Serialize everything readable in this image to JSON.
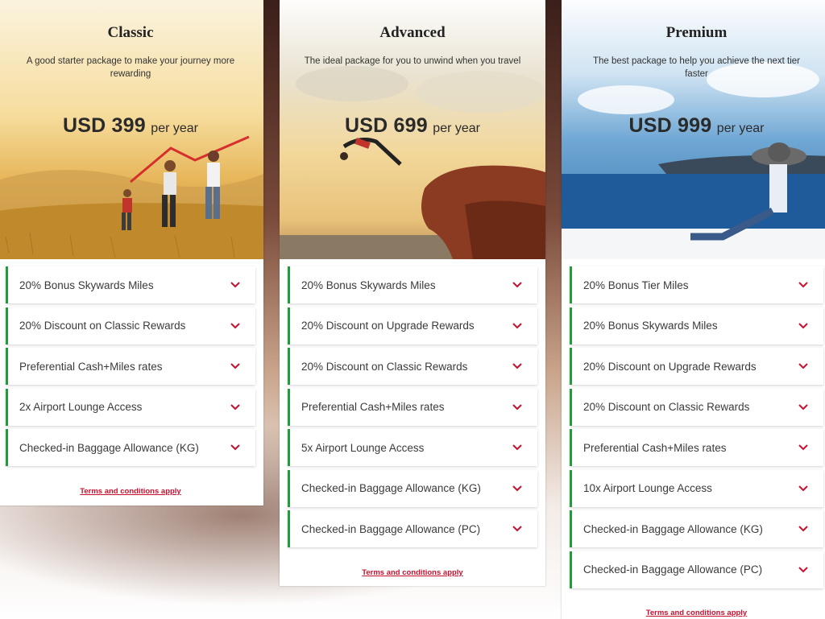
{
  "packages": [
    {
      "title": "Classic",
      "description": "A good starter package to make your journey more rewarding",
      "price": "USD 399",
      "period": "per year",
      "benefits": [
        "20% Bonus Skywards Miles",
        "20% Discount on Classic Rewards",
        "Preferential Cash+Miles rates",
        "2x Airport Lounge Access",
        "Checked-in Baggage Allowance (KG)"
      ],
      "terms": "Terms and conditions apply"
    },
    {
      "title": "Advanced",
      "description": "The ideal package for you to unwind when you travel",
      "price": "USD 699",
      "period": "per year",
      "benefits": [
        "20% Bonus Skywards Miles",
        "20% Discount on Upgrade Rewards",
        "20% Discount on Classic Rewards",
        "Preferential Cash+Miles rates",
        "5x Airport Lounge Access",
        "Checked-in Baggage Allowance (KG)",
        "Checked-in Baggage Allowance (PC)"
      ],
      "terms": "Terms and conditions apply"
    },
    {
      "title": "Premium",
      "description": "The best package to help you achieve the next tier faster",
      "price": "USD 999",
      "period": "per year",
      "benefits": [
        "20% Bonus Tier Miles",
        "20% Bonus Skywards Miles",
        "20% Discount on Upgrade Rewards",
        "20% Discount on Classic Rewards",
        "Preferential Cash+Miles rates",
        "10x Airport Lounge Access",
        "Checked-in Baggage Allowance (KG)",
        "Checked-in Baggage Allowance (PC)"
      ],
      "terms": "Terms and conditions apply"
    }
  ],
  "colors": {
    "accent_green": "#1f9d3a",
    "chevron_red": "#c8102e",
    "terms_red": "#c8102e"
  },
  "icons": {
    "expand": "chevron-down-icon"
  }
}
